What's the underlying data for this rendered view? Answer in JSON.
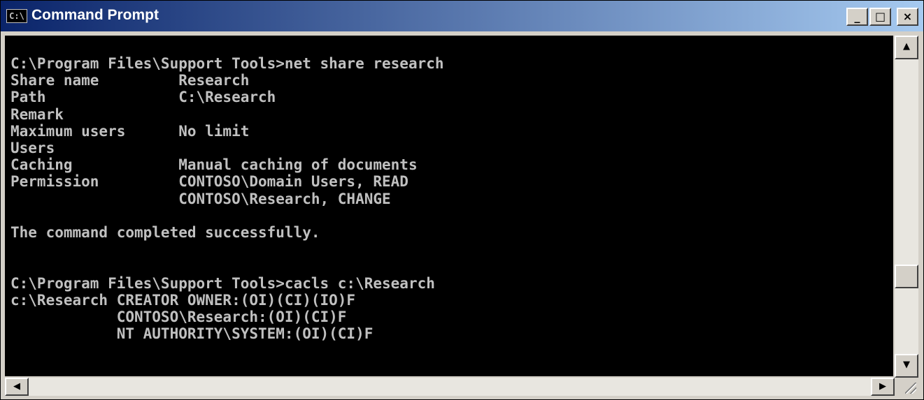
{
  "window": {
    "title": "Command Prompt",
    "icon_text": "C:\\",
    "minimize_label": "_",
    "maximize_label": "□",
    "close_label": "×"
  },
  "console": {
    "text": "C:\\Program Files\\Support Tools>net share research\nShare name         Research\nPath               C:\\Research\nRemark\nMaximum users      No limit\nUsers\nCaching            Manual caching of documents\nPermission         CONTOSO\\Domain Users, READ\n                   CONTOSO\\Research, CHANGE\n\nThe command completed successfully.\n\n\nC:\\Program Files\\Support Tools>cacls c:\\Research\nc:\\Research CREATOR OWNER:(OI)(CI)(IO)F\n            CONTOSO\\Research:(OI)(CI)F\n            NT AUTHORITY\\SYSTEM:(OI)(CI)F"
  },
  "scrollbars": {
    "up_arrow": "▲",
    "down_arrow": "▼",
    "left_arrow": "◀",
    "right_arrow": "▶"
  }
}
